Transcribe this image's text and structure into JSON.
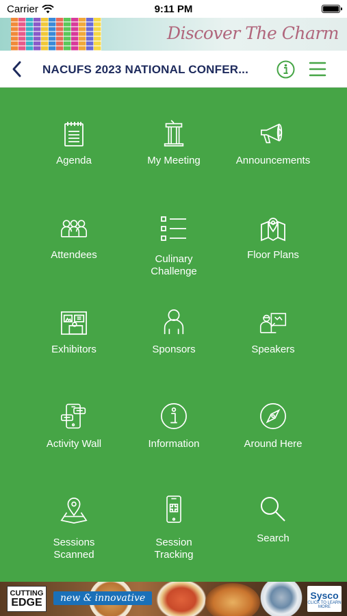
{
  "status_bar": {
    "carrier": "Carrier",
    "time": "9:11 PM"
  },
  "header_banner": {
    "tagline": "Discover The Charm"
  },
  "nav": {
    "title": "NACUFS 2023 NATIONAL CONFER...",
    "back_icon": "chevron-left-icon",
    "info_icon": "info-icon",
    "menu_icon": "hamburger-menu-icon"
  },
  "tiles": [
    {
      "label": "Agenda",
      "icon": "notepad-icon"
    },
    {
      "label": "My Meeting",
      "icon": "podium-icon"
    },
    {
      "label": "Announcements",
      "icon": "megaphone-icon"
    },
    {
      "label": "Attendees",
      "icon": "people-group-icon"
    },
    {
      "label": "Culinary\nChallenge",
      "icon": "checklist-icon"
    },
    {
      "label": "Floor Plans",
      "icon": "map-pin-icon"
    },
    {
      "label": "Exhibitors",
      "icon": "booth-icon"
    },
    {
      "label": "Sponsors",
      "icon": "person-icon"
    },
    {
      "label": "Speakers",
      "icon": "presenter-icon"
    },
    {
      "label": "Activity Wall",
      "icon": "phone-chat-icon"
    },
    {
      "label": "Information",
      "icon": "info-circle-icon"
    },
    {
      "label": "Around Here",
      "icon": "compass-icon"
    },
    {
      "label": "Sessions\nScanned",
      "icon": "location-map-icon"
    },
    {
      "label": "Session\nTracking",
      "icon": "phone-qr-icon"
    },
    {
      "label": "Search",
      "icon": "magnifier-icon"
    }
  ],
  "footer_banner": {
    "brand_top": "CUTTING",
    "brand_bottom": "EDGE",
    "ribbon": "new & innovative",
    "sponsor": "Sysco",
    "sponsor_sub": "CLICK TO LEARN MORE"
  },
  "colors": {
    "grid_green": "#46a546",
    "nav_title": "#1d2a5c",
    "nav_icon_green": "#46a546"
  }
}
